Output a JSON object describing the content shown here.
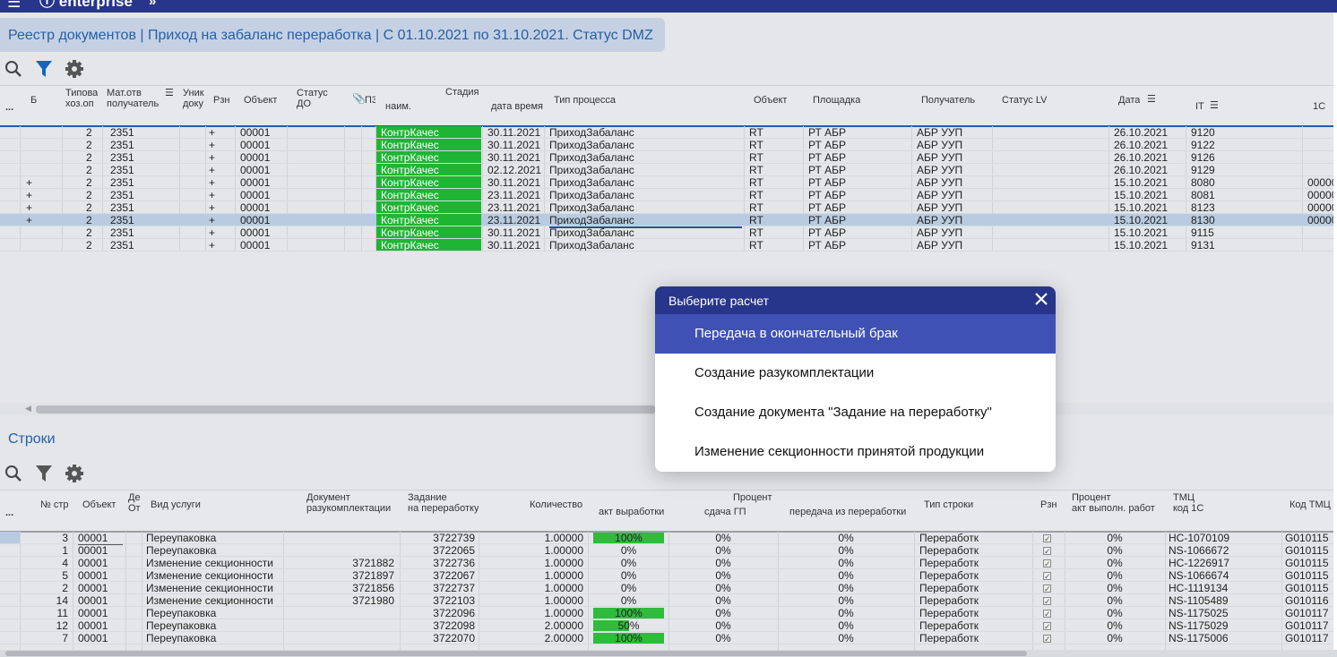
{
  "app": {
    "brand": "enterprise",
    "menu_icon": "menu-icon",
    "collapse_icon": "double-chevron-icon"
  },
  "title": "Реестр документов | Приход на забаланс переработка | С 01.10.2021 по 31.10.2021. Статус DMZ",
  "toolbar_icons": [
    "search-icon",
    "filter-icon",
    "settings-icon"
  ],
  "accent": "#27368a",
  "top_grid": {
    "more_label": "...",
    "headers": {
      "b": "Б",
      "tipovaya": "Типова\nхоз.оп",
      "mat": "Мат.отв\nполучатель",
      "unik": "Уник\nдоку",
      "rzn": "Рзн",
      "obj": "Объект",
      "status_do": "Статус\nДО",
      "pz": "П3",
      "stadiya": "Стадия",
      "naim": "наим.",
      "date_time": "дата время",
      "tip_processa": "Тип процесса",
      "obekt2": "Объект",
      "ploshadka": "Площадка",
      "poluchatel": "Получатель",
      "status_lv": "Статус LV",
      "data": "Дата",
      "it": "IT",
      "c1": "1С"
    },
    "rows": [
      {
        "b": "",
        "tip": "2",
        "mat": "2351",
        "rzn": "+",
        "obj": "00001",
        "stage": "КонтрКачес",
        "dt": "30.11.2021",
        "proc": "ПриходЗабаланс",
        "o2": "RT",
        "pl": "РТ АБР",
        "pol": "АБР УУП",
        "date": "26.10.2021",
        "it": "9120",
        "c1": ""
      },
      {
        "b": "",
        "tip": "2",
        "mat": "2351",
        "rzn": "+",
        "obj": "00001",
        "stage": "КонтрКачес",
        "dt": "30.11.2021",
        "proc": "ПриходЗабаланс",
        "o2": "RT",
        "pl": "РТ АБР",
        "pol": "АБР УУП",
        "date": "26.10.2021",
        "it": "9122",
        "c1": ""
      },
      {
        "b": "",
        "tip": "2",
        "mat": "2351",
        "rzn": "+",
        "obj": "00001",
        "stage": "КонтрКачес",
        "dt": "30.11.2021",
        "proc": "ПриходЗабаланс",
        "o2": "RT",
        "pl": "РТ АБР",
        "pol": "АБР УУП",
        "date": "26.10.2021",
        "it": "9126",
        "c1": ""
      },
      {
        "b": "",
        "tip": "2",
        "mat": "2351",
        "rzn": "+",
        "obj": "00001",
        "stage": "КонтрКачес",
        "dt": "02.12.2021",
        "proc": "ПриходЗабаланс",
        "o2": "RT",
        "pl": "РТ АБР",
        "pol": "АБР УУП",
        "date": "26.10.2021",
        "it": "9129",
        "c1": ""
      },
      {
        "b": "+",
        "tip": "2",
        "mat": "2351",
        "rzn": "+",
        "obj": "00001",
        "stage": "КонтрКачес",
        "dt": "30.11.2021",
        "proc": "ПриходЗабаланс",
        "o2": "RT",
        "pl": "РТ АБР",
        "pol": "АБР УУП",
        "date": "15.10.2021",
        "it": "8080",
        "c1": "00000"
      },
      {
        "b": "+",
        "tip": "2",
        "mat": "2351",
        "rzn": "+",
        "obj": "00001",
        "stage": "КонтрКачес",
        "dt": "23.11.2021",
        "proc": "ПриходЗабаланс",
        "o2": "RT",
        "pl": "РТ АБР",
        "pol": "АБР УУП",
        "date": "15.10.2021",
        "it": "8081",
        "c1": "00000"
      },
      {
        "b": "+",
        "tip": "2",
        "mat": "2351",
        "rzn": "+",
        "obj": "00001",
        "stage": "КонтрКачес",
        "dt": "23.11.2021",
        "proc": "ПриходЗабаланс",
        "o2": "RT",
        "pl": "РТ АБР",
        "pol": "АБР УУП",
        "date": "15.10.2021",
        "it": "8123",
        "c1": "00000"
      },
      {
        "b": "+",
        "tip": "2",
        "mat": "2351",
        "rzn": "+",
        "obj": "00001",
        "stage": "КонтрКачес",
        "dt": "23.11.2021",
        "proc": "ПриходЗабаланс",
        "o2": "RT",
        "pl": "РТ АБР",
        "pol": "АБР УУП",
        "date": "15.10.2021",
        "it": "8130",
        "c1": "00000",
        "selected": true
      },
      {
        "b": "",
        "tip": "2",
        "mat": "2351",
        "rzn": "+",
        "obj": "00001",
        "stage": "КонтрКачес",
        "dt": "30.11.2021",
        "proc": "ПриходЗабаланс",
        "o2": "RT",
        "pl": "РТ АБР",
        "pol": "АБР УУП",
        "date": "15.10.2021",
        "it": "9115",
        "c1": ""
      },
      {
        "b": "",
        "tip": "2",
        "mat": "2351",
        "rzn": "+",
        "obj": "00001",
        "stage": "КонтрКачес",
        "dt": "30.11.2021",
        "proc": "ПриходЗабаланс",
        "o2": "RT",
        "pl": "РТ АБР",
        "pol": "АБР УУП",
        "date": "15.10.2021",
        "it": "9131",
        "c1": ""
      }
    ]
  },
  "lines_section": {
    "title": "Строки",
    "headers": {
      "more": "...",
      "nstr": "№ стр",
      "obj": "Объект",
      "de": "Де\nОт",
      "vid": "Вид услуги",
      "doc": "Документ\nразукомплектации",
      "zad": "Задание\nна переработку",
      "kol": "Количество",
      "procent": "Процент",
      "akt": "акт выработки",
      "sdacha": "сдача ГП",
      "peredacha": "передача из переработки",
      "tip_stroki": "Тип строки",
      "rzn": "Рзн",
      "proc_akt": "Процент\nакт выполн. работ",
      "tmc": "ТМЦ\nкод 1С",
      "kod_tmc": "Код ТМЦ"
    },
    "rows": [
      {
        "n": "3",
        "obj": "00001",
        "vid": "Переупаковка",
        "doc": "",
        "zad": "3722739",
        "kol": "1.00000",
        "akt": "100%",
        "akt_level": 1.0,
        "sd": "0%",
        "per": "0%",
        "tip": "Переработк",
        "pa": "0%",
        "tmc": "HC-1070109",
        "kod": "G010115",
        "selected": true
      },
      {
        "n": "1",
        "obj": "00001",
        "vid": "Переупаковка",
        "doc": "",
        "zad": "3722065",
        "kol": "1.00000",
        "akt": "0%",
        "akt_level": 0,
        "sd": "0%",
        "per": "0%",
        "tip": "Переработк",
        "pa": "0%",
        "tmc": "NS-1066672",
        "kod": "G010115"
      },
      {
        "n": "4",
        "obj": "00001",
        "vid": "Изменение секционности",
        "doc": "3721882",
        "zad": "3722736",
        "kol": "1.00000",
        "akt": "0%",
        "akt_level": 0,
        "sd": "0%",
        "per": "0%",
        "tip": "Переработк",
        "pa": "0%",
        "tmc": "HC-1226917",
        "kod": "G010115"
      },
      {
        "n": "5",
        "obj": "00001",
        "vid": "Изменение секционности",
        "doc": "3721897",
        "zad": "3722067",
        "kol": "1.00000",
        "akt": "0%",
        "akt_level": 0,
        "sd": "0%",
        "per": "0%",
        "tip": "Переработк",
        "pa": "0%",
        "tmc": "NS-1066674",
        "kod": "G010115"
      },
      {
        "n": "2",
        "obj": "00001",
        "vid": "Изменение секционности",
        "doc": "3721856",
        "zad": "3722737",
        "kol": "1.00000",
        "akt": "0%",
        "akt_level": 0,
        "sd": "0%",
        "per": "0%",
        "tip": "Переработк",
        "pa": "0%",
        "tmc": "HC-1119134",
        "kod": "G010115"
      },
      {
        "n": "14",
        "obj": "00001",
        "vid": "Изменение секционности",
        "doc": "3721980",
        "zad": "3722103",
        "kol": "1.00000",
        "akt": "0%",
        "akt_level": 0,
        "sd": "0%",
        "per": "0%",
        "tip": "Переработк",
        "pa": "0%",
        "tmc": "NS-1105489",
        "kod": "G010116"
      },
      {
        "n": "11",
        "obj": "00001",
        "vid": "Переупаковка",
        "doc": "",
        "zad": "3722096",
        "kol": "1.00000",
        "akt": "100%",
        "akt_level": 1.0,
        "sd": "0%",
        "per": "0%",
        "tip": "Переработк",
        "pa": "0%",
        "tmc": "NS-1175025",
        "kod": "G010117"
      },
      {
        "n": "12",
        "obj": "00001",
        "vid": "Переупаковка",
        "doc": "",
        "zad": "3722098",
        "kol": "2.00000",
        "akt": "50%",
        "akt_level": 0.5,
        "sd": "0%",
        "per": "0%",
        "tip": "Переработк",
        "pa": "0%",
        "tmc": "NS-1175029",
        "kod": "G010117"
      },
      {
        "n": "7",
        "obj": "00001",
        "vid": "Переупаковка",
        "doc": "",
        "zad": "3722070",
        "kol": "2.00000",
        "akt": "100%",
        "akt_level": 1.0,
        "sd": "0%",
        "per": "0%",
        "tip": "Переработк",
        "pa": "0%",
        "tmc": "NS-1175006",
        "kod": "G010117"
      }
    ]
  },
  "modal": {
    "title": "Выберите расчет",
    "close_icon": "close-icon",
    "items": [
      "Передача в окончательный брак",
      "Создание разукомплектации",
      "Создание документа \"Задание на переработку\"",
      "Изменение секционности принятой продукции"
    ]
  }
}
